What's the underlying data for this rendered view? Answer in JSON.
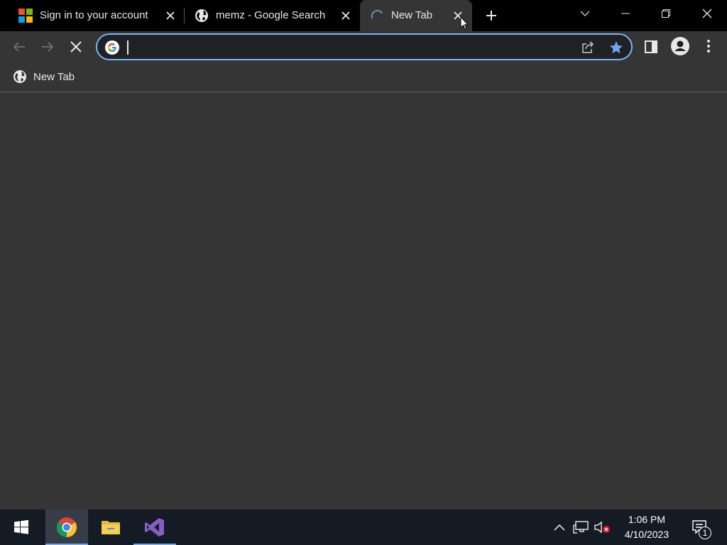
{
  "tabs": [
    {
      "title": "Sign in to your account",
      "favicon": "microsoft-logo-icon"
    },
    {
      "title": "memz - Google Search",
      "favicon": "globe-icon"
    },
    {
      "title": "New Tab",
      "favicon": "loading-spinner-icon",
      "active": true
    }
  ],
  "window_controls": [
    "tab-search-icon",
    "minimize-icon",
    "restore-icon",
    "close-icon"
  ],
  "toolbar": {
    "back": "back-arrow-icon",
    "forward": "forward-arrow-icon",
    "stop": "stop-icon",
    "omnibox_value": "",
    "omnibox_icon": "google-g-icon",
    "share": "share-icon",
    "bookmark_star": "star-icon",
    "side_panel": "side-panel-icon",
    "profile": "profile-icon",
    "menu": "kebab-menu-icon"
  },
  "bookmarks": [
    {
      "title": "New Tab",
      "icon": "globe-icon"
    }
  ],
  "taskbar": {
    "start": "windows-start-icon",
    "apps": [
      {
        "name": "chrome-icon",
        "active": true
      },
      {
        "name": "file-explorer-icon",
        "active": false
      },
      {
        "name": "visual-studio-icon",
        "active": false
      }
    ],
    "tray": [
      "chevron-up-icon",
      "network-icon",
      "volume-muted-icon"
    ],
    "time": "1:06 PM",
    "date": "4/10/2023",
    "notifications_count": "1"
  },
  "colors": {
    "tabstrip": "#000000",
    "toolbar": "#353535",
    "omnibox_border": "#7ab3f6",
    "star": "#6ea6f5",
    "taskbar": "#151b24"
  }
}
